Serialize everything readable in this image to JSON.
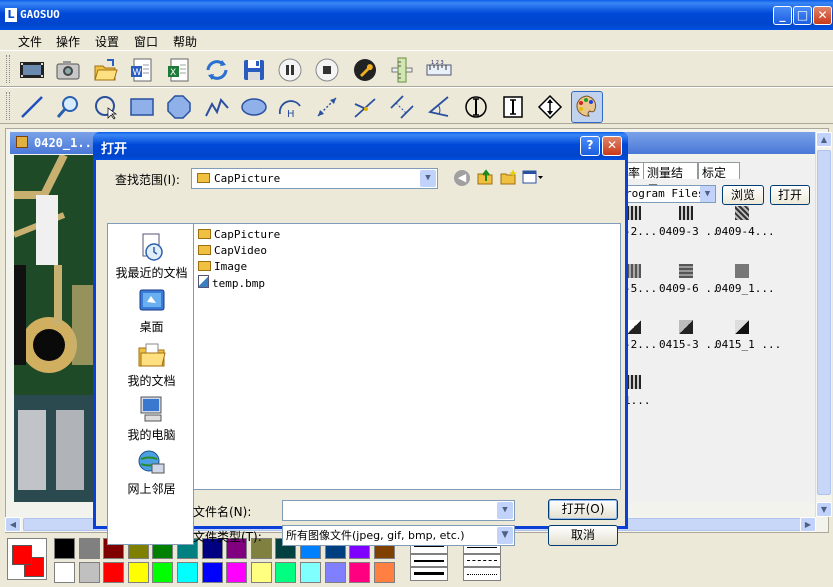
{
  "app": {
    "title": "GAOSUO",
    "logo": "L"
  },
  "menu": {
    "items": [
      "文件",
      "操作",
      "设置",
      "窗口",
      "帮助"
    ]
  },
  "toolbar1": {
    "icons": [
      "capture-video-icon",
      "camera-icon",
      "open-folder-icon",
      "word-export-icon",
      "excel-export-icon",
      "refresh-icon",
      "save-icon",
      "pause-icon",
      "stop-icon",
      "settings-wrench-icon",
      "vertical-ruler-icon",
      "horizontal-ruler-icon"
    ]
  },
  "toolbar2": {
    "icons": [
      "line-tool-icon",
      "zoom-tool-icon",
      "circle-select-tool-icon",
      "rectangle-tool-icon",
      "octagon-tool-icon",
      "polyline-tool-icon",
      "ellipse-tool-icon",
      "height-arc-tool-icon",
      "distance-tool-icon",
      "angle-point-tool-icon",
      "parallel-lines-tool-icon",
      "angle-tool-icon",
      "circle-diameter-tool-icon",
      "vertical-bar-tool-icon",
      "vertical-arrow-tool-icon",
      "palette-tool-icon"
    ]
  },
  "document": {
    "title": "0420_1.."
  },
  "right_panel": {
    "tabs": [
      "率",
      "测量结果",
      "标定"
    ],
    "folder_combo": "rogram Files",
    "browse": "浏览",
    "open": "打开",
    "thumbnails": [
      "-2...",
      "0409-3 ..",
      "0409-4...",
      "-5...",
      "0409-6 ..",
      "0409_1...",
      "-2...",
      "0415-3 ..",
      "0415_1 ...",
      "1..."
    ]
  },
  "dialog": {
    "title": "打开",
    "help": "?",
    "close": "✕",
    "look_in_label": "查找范围(I):",
    "look_in_value": "CapPicture",
    "places": [
      "我最近的文档",
      "桌面",
      "我的文档",
      "我的电脑",
      "网上邻居"
    ],
    "files": [
      {
        "name": "CapPicture",
        "type": "folder"
      },
      {
        "name": "CapVideo",
        "type": "folder"
      },
      {
        "name": "Image",
        "type": "folder"
      },
      {
        "name": "temp.bmp",
        "type": "bmp"
      }
    ],
    "filename_label": "文件名(N):",
    "filename_value": "",
    "filetype_label": "文件类型(T):",
    "filetype_value": "所有图像文件(jpeg, gif, bmp, etc.)",
    "open_button": "打开(O)",
    "cancel_button": "取消"
  },
  "palette": {
    "foreground": "#ff0000",
    "background": "#ff0000",
    "row1": [
      "#000000",
      "#808080",
      "#800000",
      "#808000",
      "#008000",
      "#008080",
      "#000080",
      "#800080",
      "#808040",
      "#004040",
      "#0080ff",
      "#004080",
      "#8000ff",
      "#804000"
    ],
    "row2": [
      "#ffffff",
      "#c0c0c0",
      "#ff0000",
      "#ffff00",
      "#00ff00",
      "#00ffff",
      "#0000ff",
      "#ff00ff",
      "#ffff80",
      "#00ff80",
      "#80ffff",
      "#8080ff",
      "#ff0080",
      "#ff8040"
    ]
  }
}
